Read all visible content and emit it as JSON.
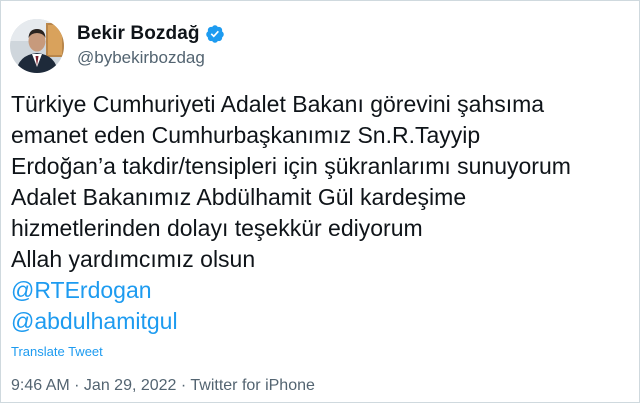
{
  "author": {
    "display_name": "Bekir Bozdağ",
    "handle": "@bybekirbozdag",
    "verified_icon": "verified-badge-icon",
    "avatar_icon": "profile-photo"
  },
  "tweet": {
    "lines": [
      "Türkiye Cumhuriyeti Adalet Bakanı görevini şahsıma",
      "emanet eden Cumhurbaşkanımız Sn.R.Tayyip",
      "Erdoğan’a takdir/tensipleri için şükranlarımı sunuyorum",
      "Adalet Bakanımız Abdülhamit Gül kardeşime",
      "hizmetlerinden dolayı teşekkür ediyorum",
      "Allah yardımcımız olsun"
    ],
    "mentions": [
      "@RTErdogan",
      "@abdulhamitgul"
    ],
    "translate_label": "Translate Tweet"
  },
  "meta": {
    "time": "9:46 AM",
    "separator": " · ",
    "date": "Jan 29, 2022",
    "source": "Twitter for iPhone"
  },
  "colors": {
    "link": "#1d9bf0",
    "text": "#0f1419",
    "secondary": "#536471"
  }
}
